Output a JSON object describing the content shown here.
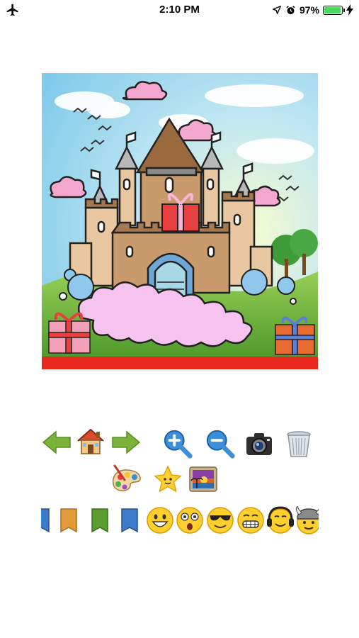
{
  "status_bar": {
    "time": "2:10 PM",
    "battery_text": "97%",
    "battery_level": 0.97,
    "battery_color": "#4cd964"
  },
  "canvas": {
    "scene": "castle-coloring-page",
    "bottom_bar_color": "#e8281f"
  },
  "toolbar": {
    "row1": [
      "undo-arrow-icon",
      "home-icon",
      "redo-arrow-icon",
      "zoom-in-icon",
      "zoom-out-icon",
      "camera-icon",
      "trash-icon"
    ],
    "row2": [
      "palette-icon",
      "star-icon",
      "image-gallery-icon"
    ]
  },
  "stickers": {
    "bookmarks": [
      {
        "icon": "blue-bookmark-icon",
        "color": "#3d7cc9"
      },
      {
        "icon": "orange-bookmark-icon",
        "color": "#e39a3b"
      },
      {
        "icon": "green-bookmark-icon",
        "color": "#5a9e2f"
      },
      {
        "icon": "blue-bookmark-icon",
        "color": "#3d7cc9"
      }
    ],
    "emojis": [
      "grinning-emoji-icon",
      "surprised-emoji-icon",
      "sunglasses-emoji-icon",
      "grimacing-emoji-icon",
      "headphones-emoji-icon",
      "viking-emoji-icon"
    ]
  }
}
